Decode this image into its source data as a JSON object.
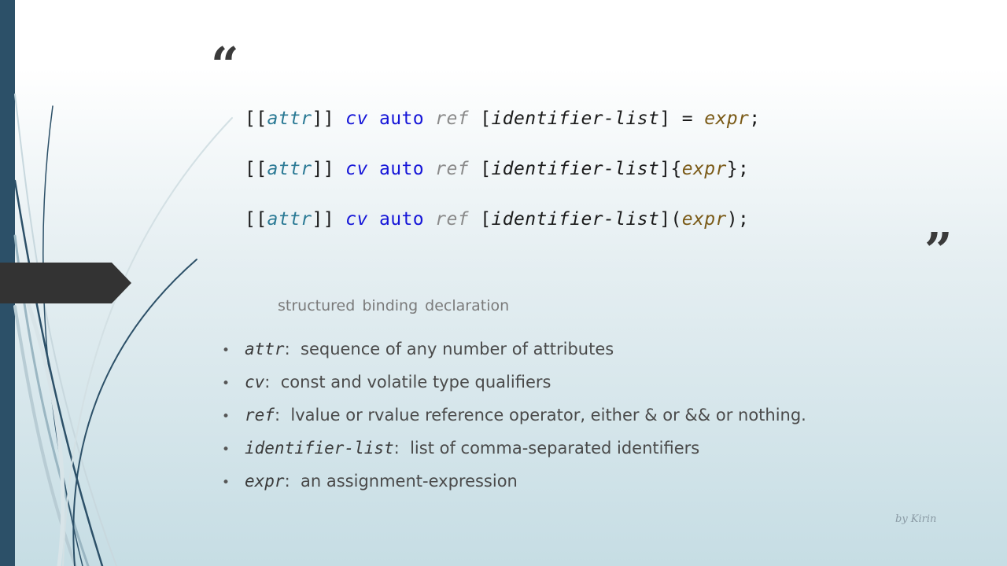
{
  "quotes": {
    "open": "“",
    "close": "”"
  },
  "code_lines": [
    [
      {
        "t": "[[",
        "k": "punct"
      },
      {
        "t": "attr",
        "k": "attr"
      },
      {
        "t": "]] ",
        "k": "punct"
      },
      {
        "t": "cv",
        "k": "cv"
      },
      {
        "t": " ",
        "k": "punct"
      },
      {
        "t": "auto",
        "k": "kw"
      },
      {
        "t": " ",
        "k": "punct"
      },
      {
        "t": "ref",
        "k": "ref"
      },
      {
        "t": " [",
        "k": "punct"
      },
      {
        "t": "identifier-list",
        "k": "id"
      },
      {
        "t": "] = ",
        "k": "punct"
      },
      {
        "t": "expr",
        "k": "expr"
      },
      {
        "t": ";",
        "k": "punct"
      }
    ],
    [
      {
        "t": "[[",
        "k": "punct"
      },
      {
        "t": "attr",
        "k": "attr"
      },
      {
        "t": "]] ",
        "k": "punct"
      },
      {
        "t": "cv",
        "k": "cv"
      },
      {
        "t": " ",
        "k": "punct"
      },
      {
        "t": "auto",
        "k": "kw"
      },
      {
        "t": " ",
        "k": "punct"
      },
      {
        "t": "ref",
        "k": "ref"
      },
      {
        "t": " [",
        "k": "punct"
      },
      {
        "t": "identifier-list",
        "k": "id"
      },
      {
        "t": "]{",
        "k": "punct"
      },
      {
        "t": "expr",
        "k": "expr"
      },
      {
        "t": "};",
        "k": "punct"
      }
    ],
    [
      {
        "t": "[[",
        "k": "punct"
      },
      {
        "t": "attr",
        "k": "attr"
      },
      {
        "t": "]] ",
        "k": "punct"
      },
      {
        "t": "cv",
        "k": "cv"
      },
      {
        "t": " ",
        "k": "punct"
      },
      {
        "t": "auto",
        "k": "kw"
      },
      {
        "t": " ",
        "k": "punct"
      },
      {
        "t": "ref",
        "k": "ref"
      },
      {
        "t": " [",
        "k": "punct"
      },
      {
        "t": "identifier-list",
        "k": "id"
      },
      {
        "t": "](",
        "k": "punct"
      },
      {
        "t": "expr",
        "k": "expr"
      },
      {
        "t": ");",
        "k": "punct"
      }
    ]
  ],
  "caption": "structured binding declaration",
  "definitions": [
    {
      "term": "attr",
      "sep": ":  ",
      "desc": "sequence of any number of attributes"
    },
    {
      "term": "cv",
      "sep": ":  ",
      "desc": "const and volatile type qualifiers"
    },
    {
      "term": "ref",
      "sep": ":  ",
      "desc": "lvalue or rvalue reference operator, either & or && or nothing."
    },
    {
      "term": "identifier-list",
      "sep": ":  ",
      "desc": "list of comma-separated identifiers"
    },
    {
      "term": "expr",
      "sep": ":  ",
      "desc": "an assignment-expression"
    }
  ],
  "bullet_glyph": "•",
  "signature": "by Kirin",
  "colors": {
    "left_bar": "#2c5068",
    "arrow_tab": "#333333",
    "attr": "#2b7a95",
    "keyword": "#1515d8",
    "ref": "#8a8a8a",
    "expr": "#7a5a17"
  }
}
